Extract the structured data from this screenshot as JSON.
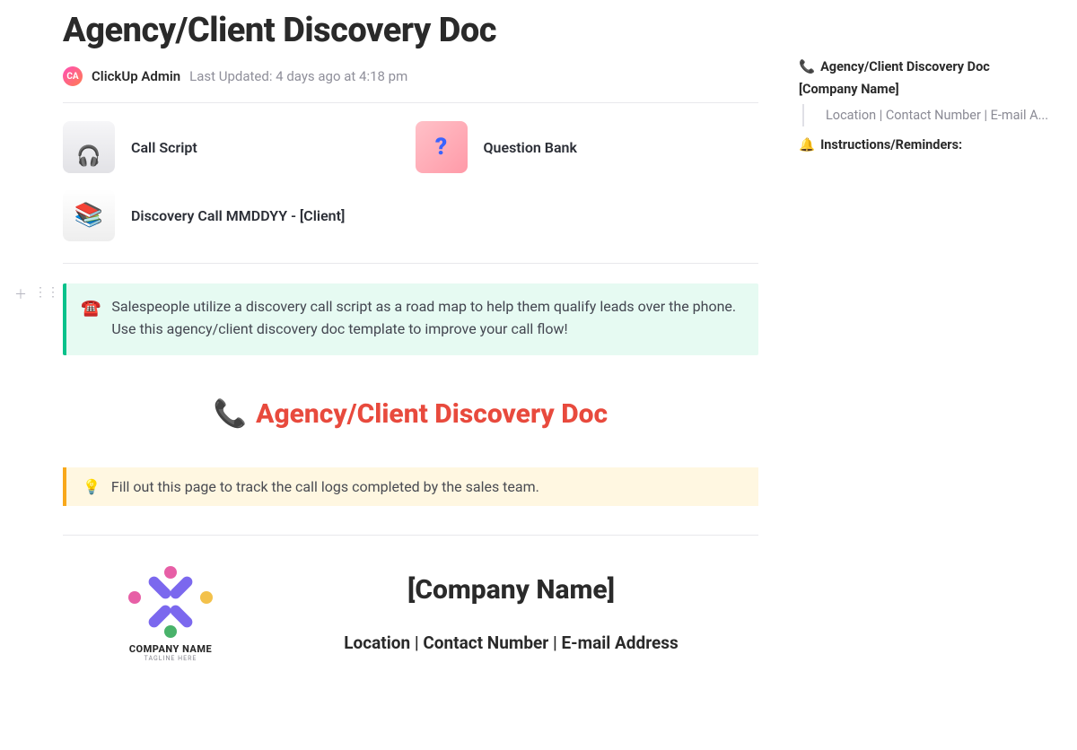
{
  "header": {
    "title": "Agency/Client Discovery Doc",
    "avatar_initials": "CA",
    "author": "ClickUp Admin",
    "updated_label": "Last Updated: 4 days ago at 4:18 pm"
  },
  "subpages": [
    {
      "label": "Call Script"
    },
    {
      "label": "Question Bank"
    },
    {
      "label": "Discovery Call MMDDYY - [Client]"
    }
  ],
  "intro_callout": {
    "emoji": "☎️",
    "text": "Salespeople utilize a discovery call script as a road map to help them qualify leads over the phone. Use this agency/client discovery doc template to improve your call flow!"
  },
  "red_heading": {
    "emoji": "📞",
    "text": "Agency/Client Discovery Doc"
  },
  "tip": {
    "emoji": "💡",
    "text": "Fill out this page to track the call logs completed by the sales team."
  },
  "company": {
    "logo_name": "COMPANY NAME",
    "logo_tagline": "TAGLINE HERE",
    "name": "[Company Name]",
    "subline": "Location | Contact Number | E-mail Address"
  },
  "outline": {
    "item1_emoji": "📞",
    "item1_text": "Agency/Client Discovery Doc",
    "item2_text": "[Company Name]",
    "item2_sub": "Location | Contact Number | E-mail A...",
    "item3_emoji": "🔔",
    "item3_text": "Instructions/Reminders:"
  }
}
